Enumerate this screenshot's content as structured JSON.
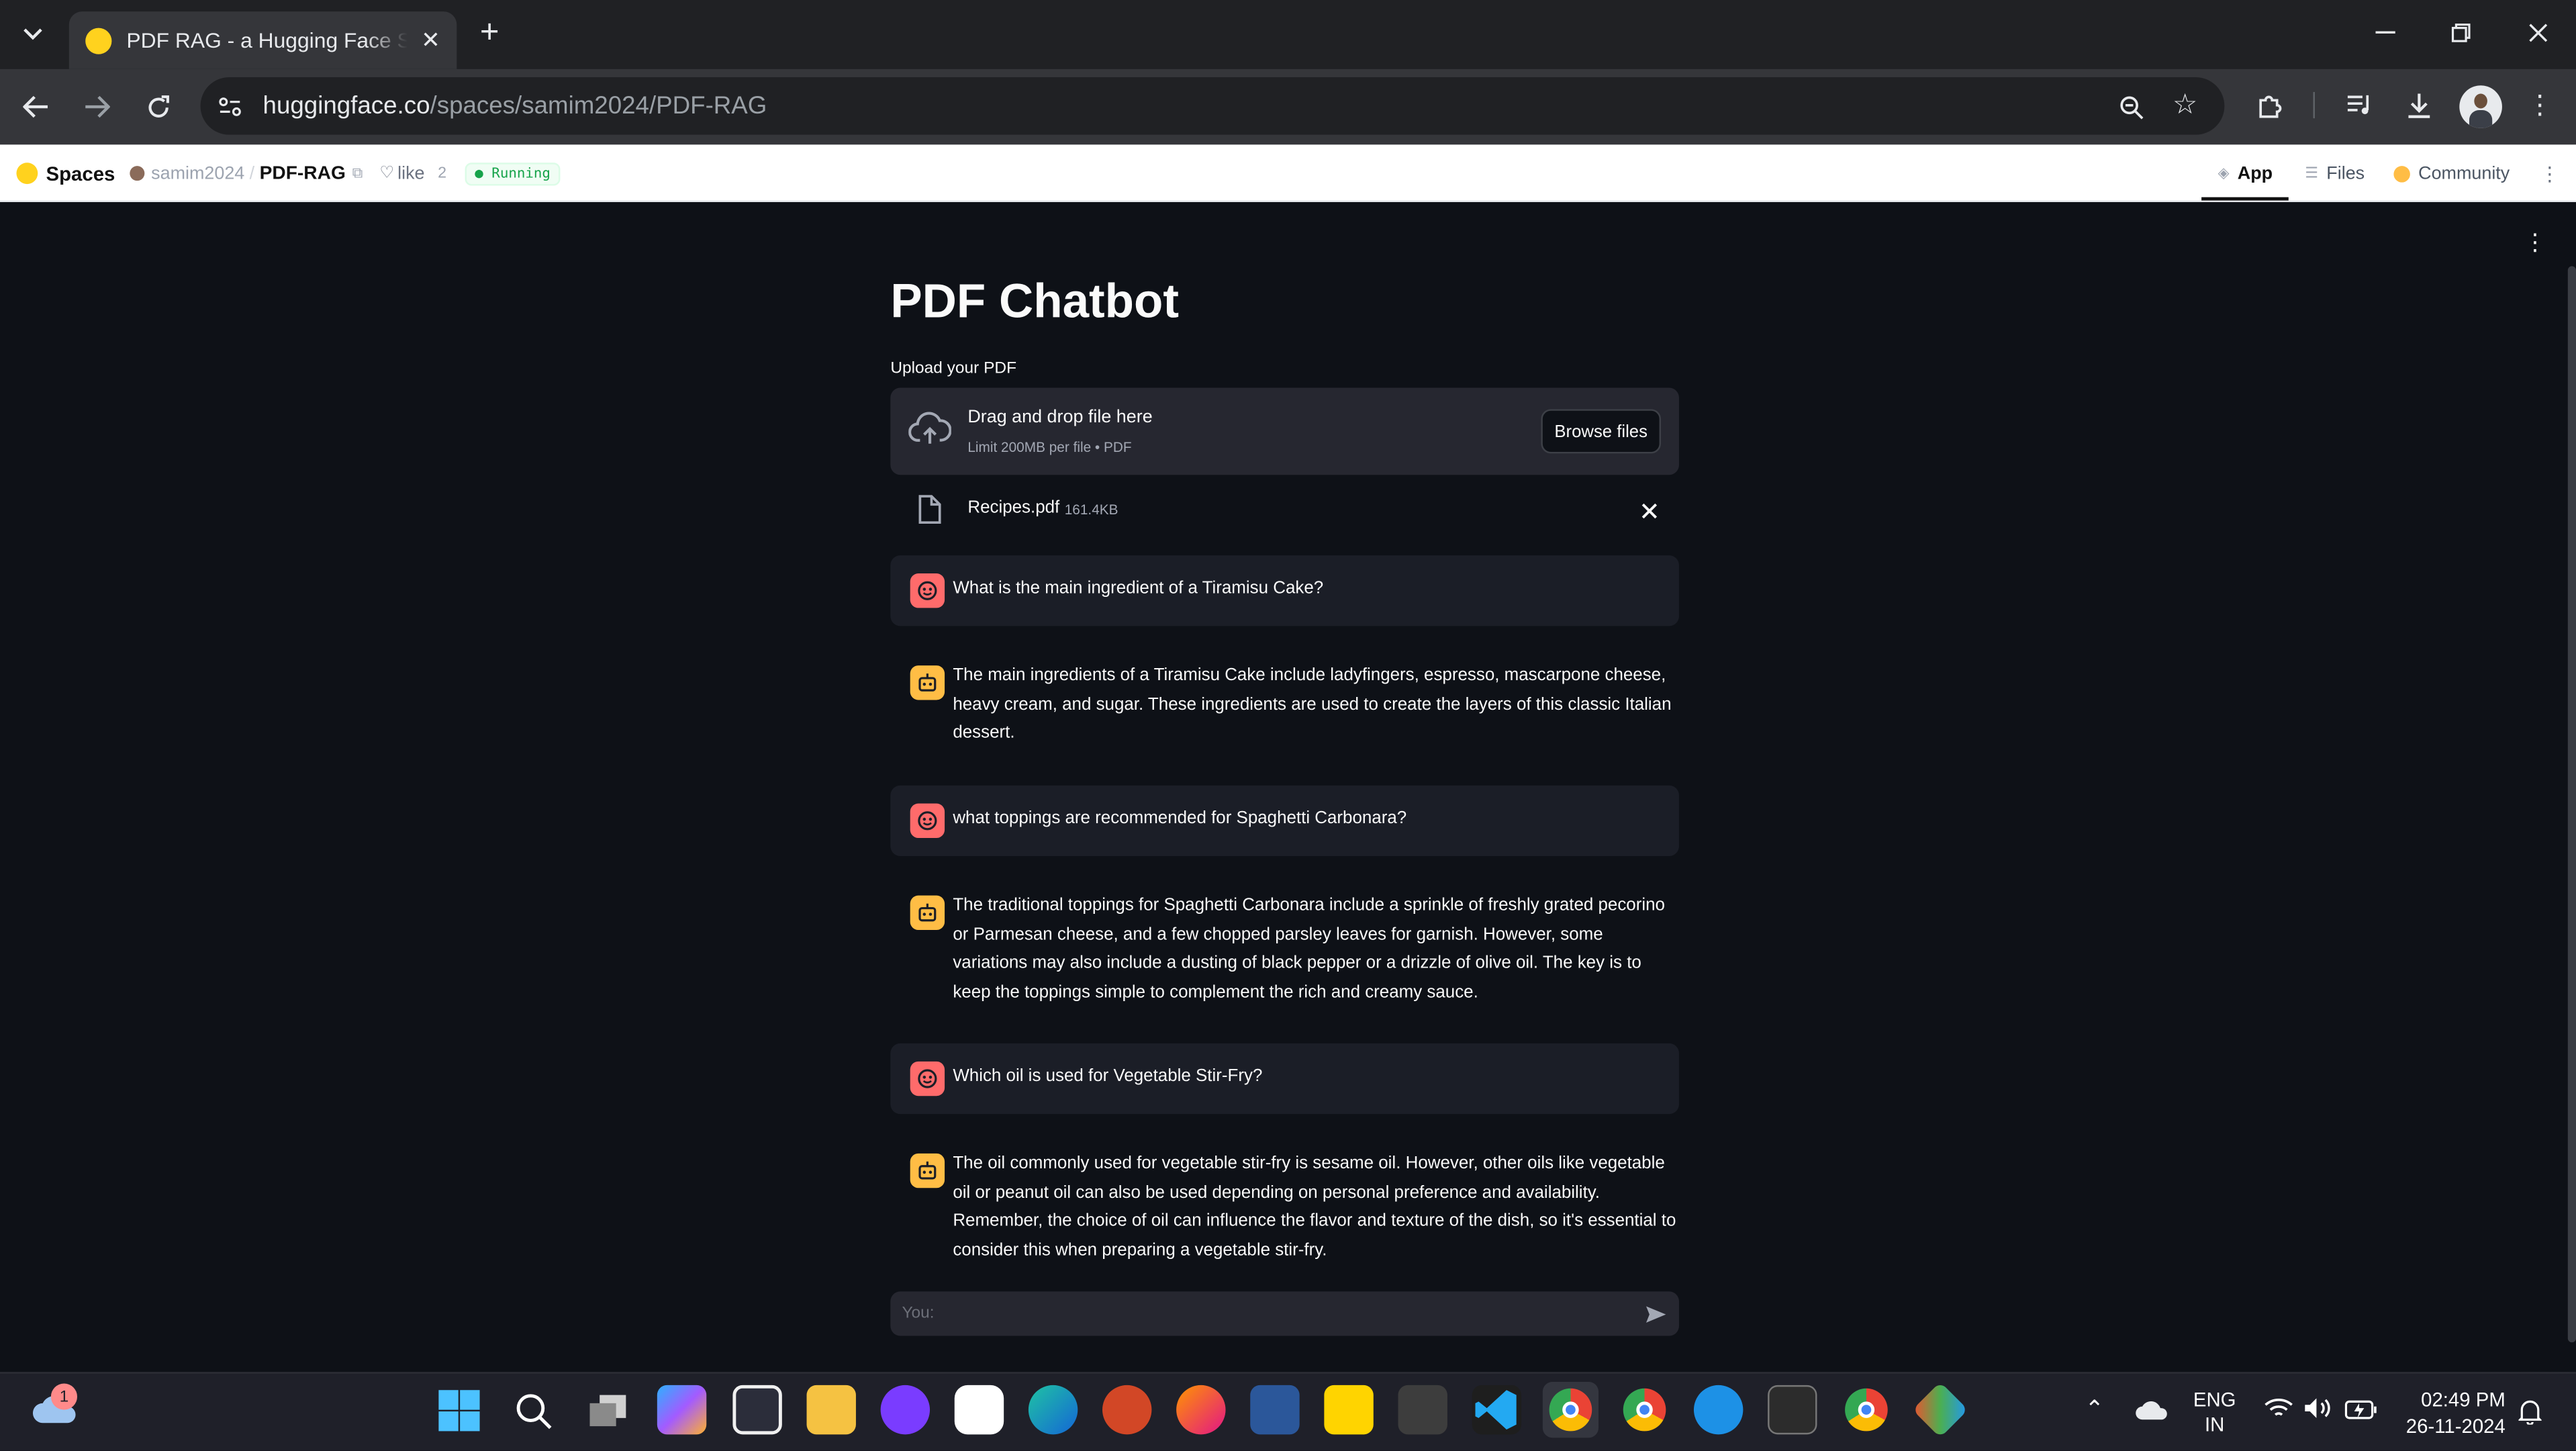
{
  "browser": {
    "tab_title": "PDF RAG - a Hugging Face Space by samim2024",
    "url_host": "huggingface.co",
    "url_path": "/spaces/samim2024/PDF-RAG"
  },
  "hf_header": {
    "spaces_label": "Spaces",
    "owner": "samim2024",
    "separator": "/",
    "space_name": "PDF-RAG",
    "like_label": "like",
    "like_count": "2",
    "status": "Running",
    "nav": [
      {
        "label": "App"
      },
      {
        "label": "Files"
      },
      {
        "label": "Community"
      }
    ]
  },
  "app": {
    "title": "PDF Chatbot",
    "upload_label": "Upload your PDF",
    "dropzone_title": "Drag and drop file here",
    "dropzone_hint": "Limit 200MB per file • PDF",
    "browse_label": "Browse files",
    "file_name": "Recipes.pdf",
    "file_size": "161.4KB",
    "chat_placeholder": "You:"
  },
  "messages": [
    {
      "role": "user",
      "text": "What is the main ingredient of a Tiramisu Cake?"
    },
    {
      "role": "assistant",
      "text": "The main ingredients of a Tiramisu Cake include ladyfingers, espresso, mascarpone cheese, heavy cream, and sugar. These ingredients are used to create the layers of this classic Italian dessert."
    },
    {
      "role": "user",
      "text": "what toppings are recommended for Spaghetti Carbonara?"
    },
    {
      "role": "assistant",
      "text": "The traditional toppings for Spaghetti Carbonara include a sprinkle of freshly grated pecorino or Parmesan cheese, and a few chopped parsley leaves for garnish. However, some variations may also include a dusting of black pepper or a drizzle of olive oil. The key is to keep the toppings simple to complement the rich and creamy sauce."
    },
    {
      "role": "user",
      "text": "Which oil is used for Vegetable Stir-Fry?"
    },
    {
      "role": "assistant",
      "text": "The oil commonly used for vegetable stir-fry is sesame oil. However, other oils like vegetable oil or peanut oil can also be used depending on personal preference and availability. Remember, the choice of oil can influence the flavor and texture of the dish, so it's essential to consider this when preparing a vegetable stir-fry."
    }
  ],
  "taskbar": {
    "weather_badge": "1",
    "lang_line1": "ENG",
    "lang_line2": "IN",
    "time": "02:49 PM",
    "date": "26-11-2024"
  },
  "colors": {
    "app_bg": "#0e1117",
    "user_avatar": "#ff6b6b",
    "bot_avatar": "#ffbd45",
    "running_green": "#16a34a"
  }
}
